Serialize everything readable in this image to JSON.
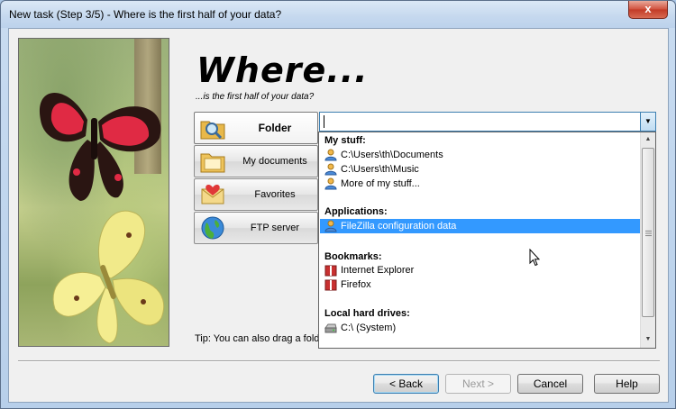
{
  "window": {
    "title": "New task (Step 3/5) - Where is the first half of your data?",
    "close_glyph": "x"
  },
  "header": {
    "title": "Where...",
    "subtitle": "...is the first half of your data?"
  },
  "sources": [
    {
      "label": "Folder",
      "icon": "folder-search-icon",
      "active": true
    },
    {
      "label": "My documents",
      "icon": "documents-folder-icon",
      "active": false
    },
    {
      "label": "Favorites",
      "icon": "favorites-heart-envelope-icon",
      "active": false
    },
    {
      "label": "FTP server",
      "icon": "globe-icon",
      "active": false
    }
  ],
  "combo": {
    "value": "",
    "arrow_glyph": "▼"
  },
  "dropdown": {
    "groups": [
      {
        "label": "My stuff:",
        "items": [
          {
            "label": "C:\\Users\\th\\Documents",
            "icon": "user-icon"
          },
          {
            "label": "C:\\Users\\th\\Music",
            "icon": "user-icon"
          },
          {
            "label": "More of my stuff...",
            "icon": "user-icon"
          }
        ]
      },
      {
        "label": "Applications:",
        "items": [
          {
            "label": "FileZilla configuration data",
            "icon": "user-icon",
            "selected": true
          }
        ]
      },
      {
        "label": "Bookmarks:",
        "items": [
          {
            "label": "Internet Explorer",
            "icon": "book-icon"
          },
          {
            "label": "Firefox",
            "icon": "book-icon"
          }
        ]
      },
      {
        "label": "Local hard drives:",
        "items": [
          {
            "label": "C:\\ (System)",
            "icon": "hard-drive-icon"
          }
        ]
      }
    ],
    "scroll_up": "▲",
    "scroll_down": "▼"
  },
  "tip": "Tip: You can also drag a folde",
  "footer": {
    "back": "< Back",
    "next": "Next >",
    "cancel": "Cancel",
    "help": "Help"
  },
  "colors": {
    "selection": "#3399ff",
    "combo_border": "#3c7fb1"
  }
}
